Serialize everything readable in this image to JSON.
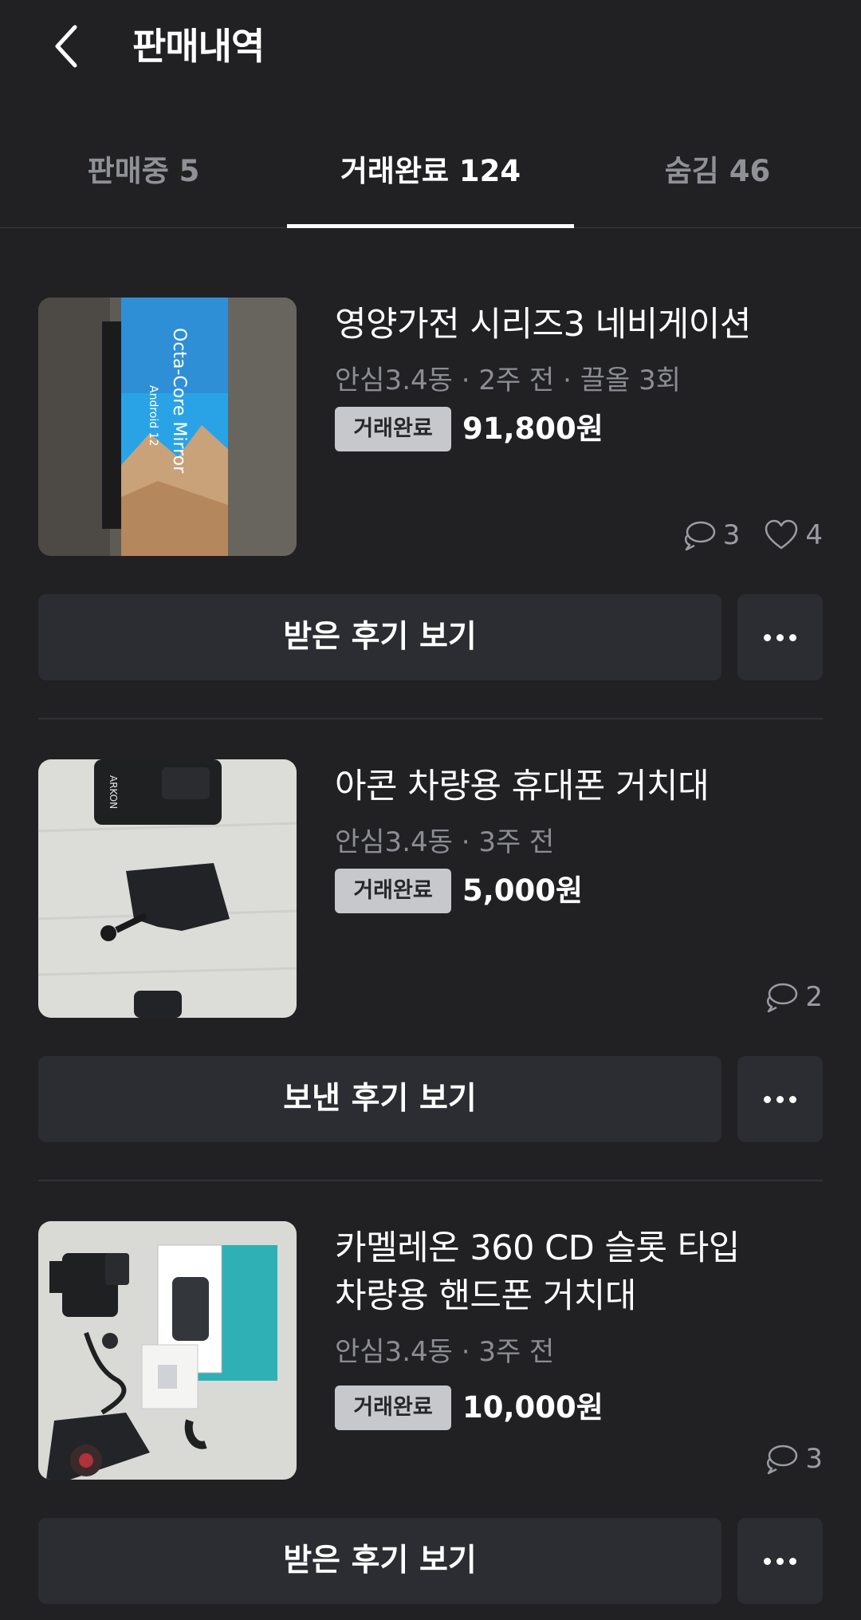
{
  "header": {
    "title": "판매내역"
  },
  "tabs": [
    {
      "label": "판매중 5"
    },
    {
      "label": "거래완료 124"
    },
    {
      "label": "숨김 46"
    }
  ],
  "items": [
    {
      "title": "영양가전 시리즈3 네비게이션",
      "meta": "안심3.4동 · 2주 전 · 끌올 3회",
      "badge": "거래완료",
      "price": "91,800원",
      "chats": "3",
      "likes": "4",
      "review_label": "받은 후기 보기",
      "thumb_text1": "Octa-Core Mirror",
      "thumb_text2": "Android 12"
    },
    {
      "title": "아콘 차량용 휴대폰 거치대",
      "meta": "안심3.4동 · 3주 전",
      "badge": "거래완료",
      "price": "5,000원",
      "chats": "2",
      "review_label": "보낸 후기 보기",
      "thumb_text1": "ARKON"
    },
    {
      "title": "카멜레온 360 CD 슬롯 타입\n차량용 핸드폰 거치대",
      "title_line1": "카멜레온 360 CD 슬롯 타입",
      "title_line2": "차량용 핸드폰 거치대",
      "meta": "안심3.4동 · 3주 전",
      "badge": "거래완료",
      "price": "10,000원",
      "chats": "3",
      "review_label": "받은 후기 보기"
    }
  ],
  "icons": {
    "back": "chevron-left-icon",
    "chat": "chat-bubbles-icon",
    "like": "heart-icon",
    "more": "more-dots-icon"
  },
  "colors": {
    "background": "#212124",
    "button": "#2c2d32",
    "badge": "#c6c8cc",
    "muted_text": "#8b8d93"
  }
}
